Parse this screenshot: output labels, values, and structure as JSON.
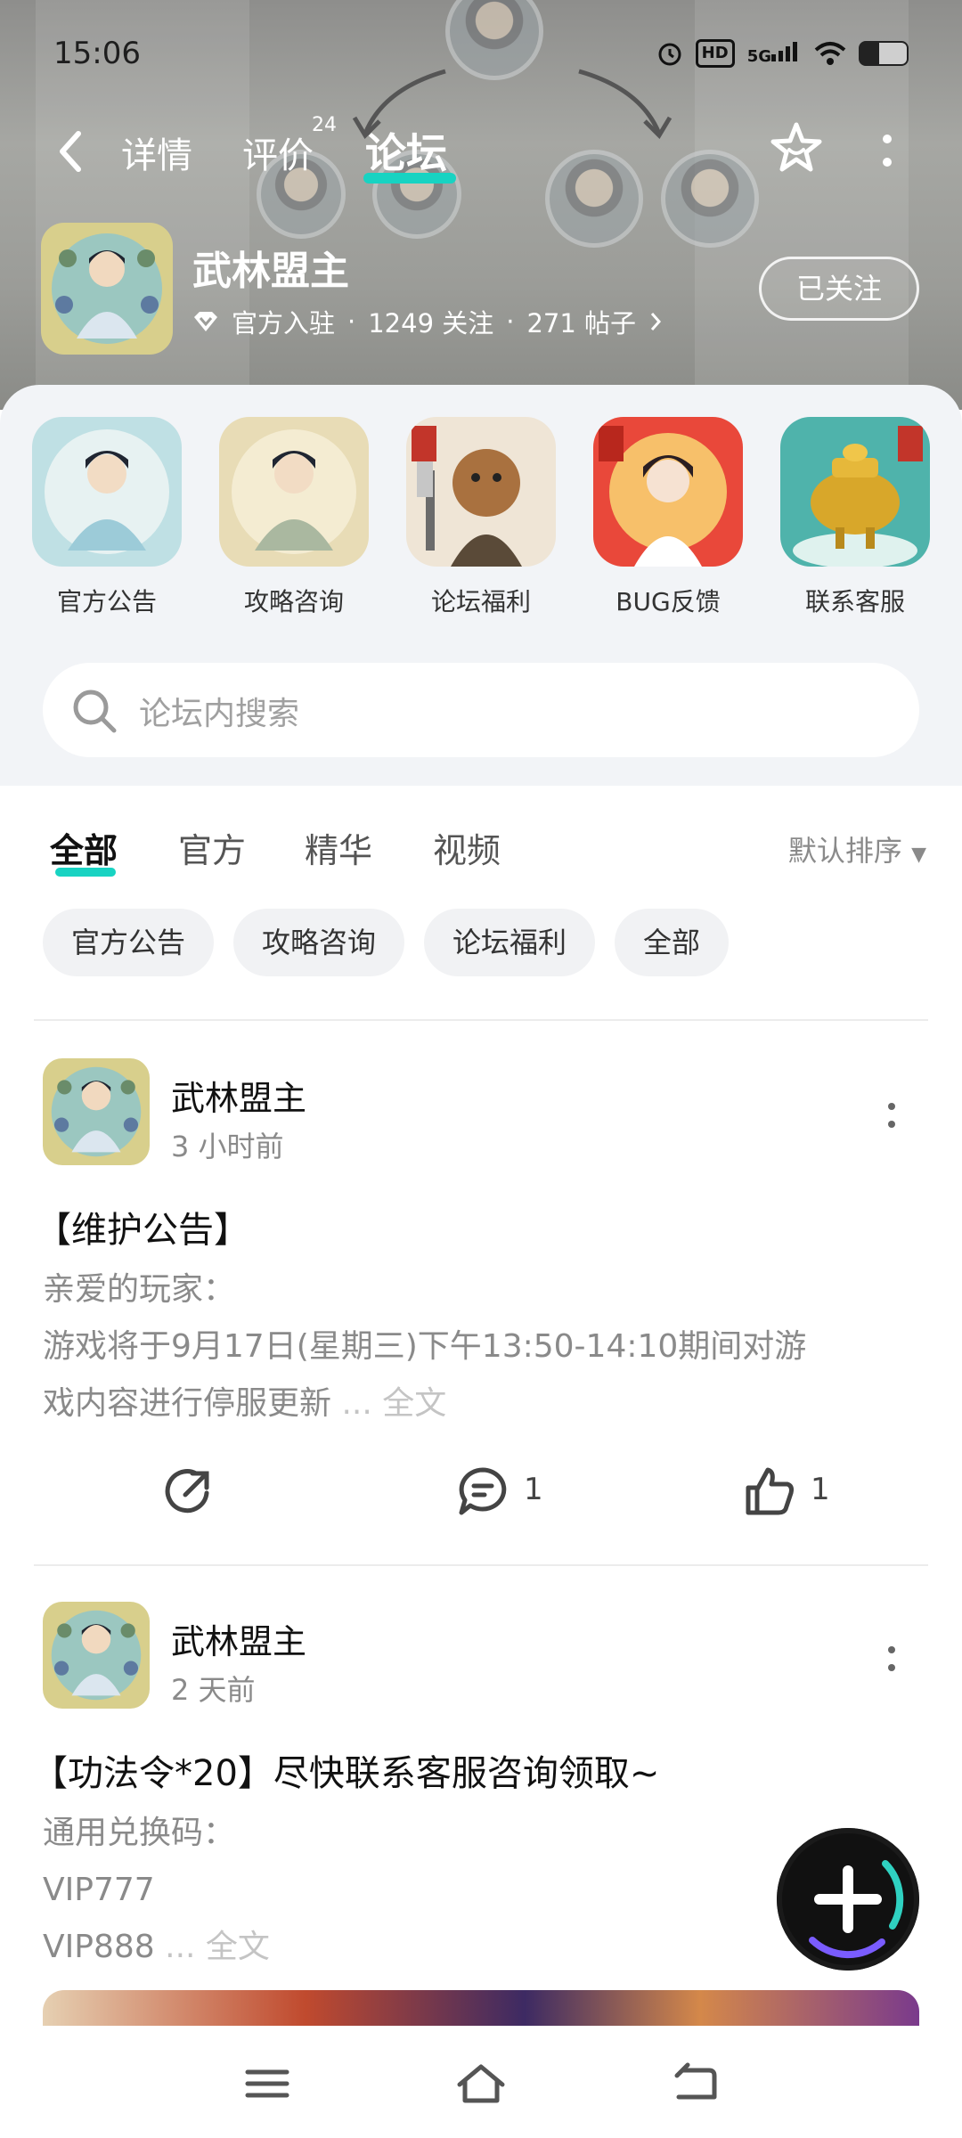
{
  "status_bar": {
    "time": "15:06",
    "network": "5G",
    "hd": "HD"
  },
  "nav": {
    "tabs": [
      {
        "label": "详情"
      },
      {
        "label": "评价",
        "badge": "24"
      },
      {
        "label": "论坛"
      }
    ],
    "active_tab": "论坛"
  },
  "forum": {
    "name": "武林盟主",
    "official": "官方入驻",
    "followers": "1249 关注",
    "posts": "271 帖子",
    "follow_label": "已关注"
  },
  "shortcuts": [
    {
      "label": "官方公告",
      "icon": "cultivator-icon"
    },
    {
      "label": "攻略咨询",
      "icon": "cultivator-icon"
    },
    {
      "label": "论坛福利",
      "icon": "bear-warrior-icon"
    },
    {
      "label": "BUG反馈",
      "icon": "immortal-girl-icon"
    },
    {
      "label": "联系客服",
      "icon": "golden-cauldron-icon"
    }
  ],
  "search": {
    "placeholder": "论坛内搜索"
  },
  "filter_tabs": [
    "全部",
    "官方",
    "精华",
    "视频"
  ],
  "sort_label": "默认排序",
  "chips": [
    "官方公告",
    "攻略咨询",
    "论坛福利",
    "全部"
  ],
  "posts": [
    {
      "author": "武林盟主",
      "time": "3 小时前",
      "title": "【维护公告】",
      "body_lines": [
        "亲爱的玩家：",
        "游戏将于9月17日(星期三)下午13:50-14:10期间对游",
        "戏内容进行停服更新"
      ],
      "more": "... 全文",
      "comments": "1",
      "likes": "1"
    },
    {
      "author": "武林盟主",
      "time": "2 天前",
      "title": "【功法令*20】尽快联系客服咨询领取~",
      "body_lines": [
        "通用兑换码：",
        "VIP777",
        "VIP888"
      ],
      "more": "... 全文"
    }
  ],
  "colors": {
    "accent": "#18d3c2",
    "header_bg": "#9d9e9a",
    "muted_text": "#8a8a8a"
  }
}
